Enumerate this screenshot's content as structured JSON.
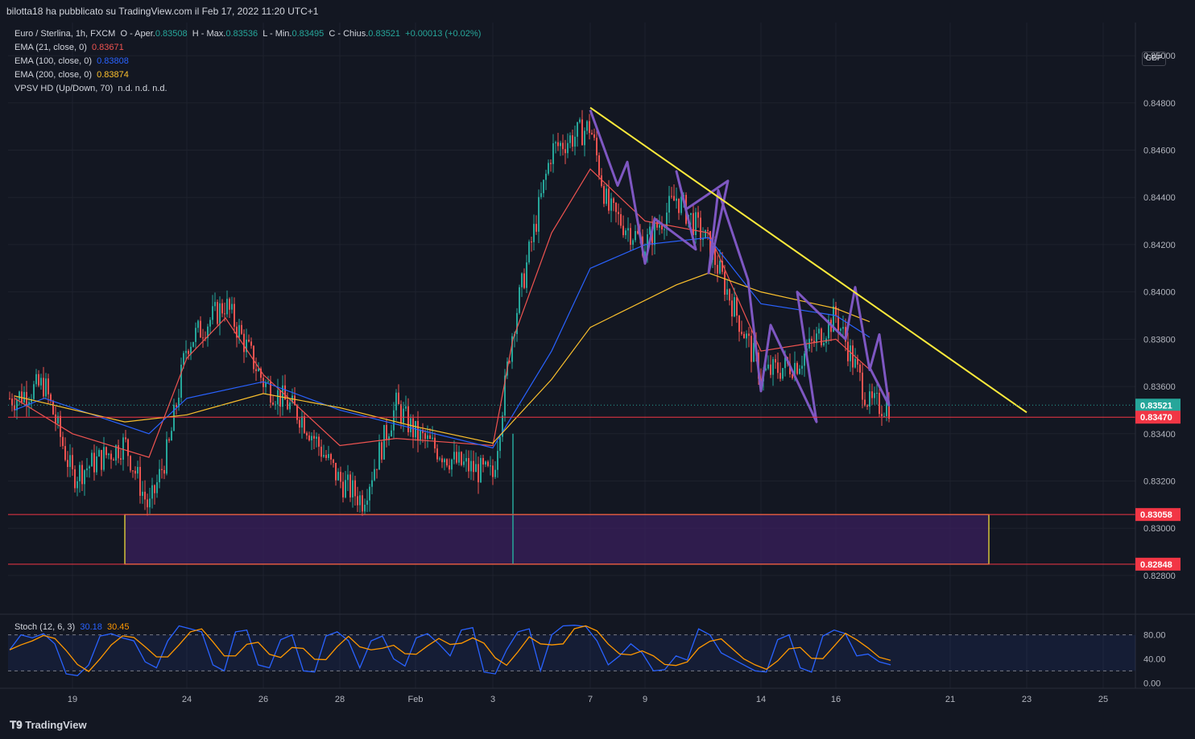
{
  "header": {
    "published": "bilotta18 ha pubblicato su TradingView.com il Feb 17, 2022 11:20 UTC+1"
  },
  "legend": {
    "symbol": "Euro / Sterlina, 1h, FXCM",
    "ohlc_prefix_o": "O - Aper.",
    "open": "0.83508",
    "h_prefix": "H - Max.",
    "high": "0.83536",
    "l_prefix": "L - Min.",
    "low": "0.83495",
    "c_prefix": "C - Chius.",
    "close": "0.83521",
    "change": "+0.00013 (+0.02%)",
    "ema21_label": "EMA (21, close, 0)",
    "ema21_value": "0.83671",
    "ema100_label": "EMA (100, close, 0)",
    "ema100_value": "0.83808",
    "ema200_label": "EMA (200, close, 0)",
    "ema200_value": "0.83874",
    "vpsv_label": "VPSV HD (Up/Down, 70)",
    "vpsv_value": "n.d.  n.d.  n.d.",
    "stoch_label": "Stoch (12, 6, 3)",
    "stoch_k": "30.18",
    "stoch_d": "30.45"
  },
  "currency": "GBP",
  "footer": {
    "brand": "TradingView"
  },
  "colors": {
    "background": "#131722",
    "up": "#26a69a",
    "down": "#ef5350",
    "ema21": "#ef5350",
    "ema100": "#2962ff",
    "ema200": "#fbc02d",
    "trendline": "#ffeb3b",
    "pattern": "#7e57c2",
    "level": "#f23645"
  },
  "chart_data": {
    "type": "candlestick",
    "symbol": "EURGBP",
    "interval": "1h",
    "x_ticks": [
      "19",
      "24",
      "26",
      "28",
      "Feb",
      "3",
      "7",
      "9",
      "14",
      "16",
      "21",
      "23",
      "25"
    ],
    "y_ticks": [
      "0.85000",
      "0.84800",
      "0.84600",
      "0.84400",
      "0.84200",
      "0.84000",
      "0.83800",
      "0.83600",
      "0.83400",
      "0.83200",
      "0.83000",
      "0.82800"
    ],
    "ylim": [
      0.8266,
      0.8514
    ],
    "price_labels": [
      {
        "value": 0.83521,
        "text": "0.83521",
        "kind": "last"
      },
      {
        "value": 0.8347,
        "text": "0.83470",
        "kind": "level"
      },
      {
        "value": 0.83058,
        "text": "0.83058",
        "kind": "level"
      },
      {
        "value": 0.82848,
        "text": "0.82848",
        "kind": "level"
      }
    ],
    "demand_zone": {
      "from_date": "2022-01-20",
      "to_date": "2022-02-22",
      "low": 0.82848,
      "high": 0.83058
    },
    "trendline": {
      "start": {
        "date": "2022-02-07",
        "price": 0.8478
      },
      "end": {
        "date": "2022-02-23",
        "price": 0.8349
      }
    },
    "pattern_path": [
      {
        "date": "2022-02-07",
        "price": 0.8477
      },
      {
        "date": "2022-02-08",
        "price": 0.8445
      },
      {
        "date": "2022-02-08",
        "price": 0.8455
      },
      {
        "date": "2022-02-09",
        "price": 0.8412
      },
      {
        "date": "2022-02-09",
        "price": 0.8431
      },
      {
        "date": "2022-02-10",
        "price": 0.8418
      },
      {
        "date": "2022-02-10",
        "price": 0.8451
      },
      {
        "date": "2022-02-10",
        "price": 0.8435
      },
      {
        "date": "2022-02-11",
        "price": 0.8447
      },
      {
        "date": "2022-02-11",
        "price": 0.8408
      },
      {
        "date": "2022-02-11",
        "price": 0.8443
      },
      {
        "date": "2022-02-12",
        "price": 0.8405
      },
      {
        "date": "2022-02-14",
        "price": 0.8358
      },
      {
        "date": "2022-02-14",
        "price": 0.8386
      },
      {
        "date": "2022-02-15",
        "price": 0.8345
      },
      {
        "date": "2022-02-15",
        "price": 0.84
      },
      {
        "date": "2022-02-16",
        "price": 0.838
      },
      {
        "date": "2022-02-16",
        "price": 0.8402
      },
      {
        "date": "2022-02-17",
        "price": 0.8367
      },
      {
        "date": "2022-02-17",
        "price": 0.8382
      },
      {
        "date": "2022-02-17",
        "price": 0.8352
      },
      {
        "date": "2022-02-17",
        "price": 0.8368
      }
    ],
    "close_path": [
      {
        "date": "2022-01-17",
        "price": 0.8355
      },
      {
        "date": "2022-01-18",
        "price": 0.8361
      },
      {
        "date": "2022-01-19",
        "price": 0.8322
      },
      {
        "date": "2022-01-20",
        "price": 0.8336
      },
      {
        "date": "2022-01-21",
        "price": 0.8308
      },
      {
        "date": "2022-01-22",
        "price": 0.8335
      },
      {
        "date": "2022-01-24",
        "price": 0.8378
      },
      {
        "date": "2022-01-25",
        "price": 0.8395
      },
      {
        "date": "2022-01-26",
        "price": 0.8362
      },
      {
        "date": "2022-01-27",
        "price": 0.8347
      },
      {
        "date": "2022-01-28",
        "price": 0.832
      },
      {
        "date": "2022-01-29",
        "price": 0.8312
      },
      {
        "date": "2022-01-31",
        "price": 0.8352
      },
      {
        "date": "2022-02-01",
        "price": 0.834
      },
      {
        "date": "2022-02-02",
        "price": 0.8328
      },
      {
        "date": "2022-02-03",
        "price": 0.8322
      },
      {
        "date": "2022-02-04",
        "price": 0.8385
      },
      {
        "date": "2022-02-05",
        "price": 0.846
      },
      {
        "date": "2022-02-07",
        "price": 0.847
      },
      {
        "date": "2022-02-08",
        "price": 0.8435
      },
      {
        "date": "2022-02-09",
        "price": 0.842
      },
      {
        "date": "2022-02-10",
        "price": 0.844
      },
      {
        "date": "2022-02-11",
        "price": 0.842
      },
      {
        "date": "2022-02-14",
        "price": 0.8365
      },
      {
        "date": "2022-02-15",
        "price": 0.837
      },
      {
        "date": "2022-02-16",
        "price": 0.839
      },
      {
        "date": "2022-02-17",
        "price": 0.83521
      }
    ],
    "ema21_path": [
      {
        "date": "2022-01-17",
        "price": 0.8355
      },
      {
        "date": "2022-01-19",
        "price": 0.834
      },
      {
        "date": "2022-01-21",
        "price": 0.833
      },
      {
        "date": "2022-01-24",
        "price": 0.8372
      },
      {
        "date": "2022-01-25",
        "price": 0.8389
      },
      {
        "date": "2022-01-26",
        "price": 0.8365
      },
      {
        "date": "2022-01-28",
        "price": 0.8335
      },
      {
        "date": "2022-01-31",
        "price": 0.8338
      },
      {
        "date": "2022-02-03",
        "price": 0.8335
      },
      {
        "date": "2022-02-04",
        "price": 0.838
      },
      {
        "date": "2022-02-05",
        "price": 0.8425
      },
      {
        "date": "2022-02-07",
        "price": 0.8452
      },
      {
        "date": "2022-02-09",
        "price": 0.843
      },
      {
        "date": "2022-02-11",
        "price": 0.8425
      },
      {
        "date": "2022-02-14",
        "price": 0.8375
      },
      {
        "date": "2022-02-16",
        "price": 0.838
      },
      {
        "date": "2022-02-17",
        "price": 0.83671
      }
    ],
    "ema100_path": [
      {
        "date": "2022-01-17",
        "price": 0.835
      },
      {
        "date": "2022-01-18",
        "price": 0.8355
      },
      {
        "date": "2022-01-21",
        "price": 0.834
      },
      {
        "date": "2022-01-24",
        "price": 0.8355
      },
      {
        "date": "2022-01-26",
        "price": 0.8362
      },
      {
        "date": "2022-01-28",
        "price": 0.835
      },
      {
        "date": "2022-02-01",
        "price": 0.8342
      },
      {
        "date": "2022-02-03",
        "price": 0.8334
      },
      {
        "date": "2022-02-05",
        "price": 0.8375
      },
      {
        "date": "2022-02-07",
        "price": 0.841
      },
      {
        "date": "2022-02-09",
        "price": 0.842
      },
      {
        "date": "2022-02-11",
        "price": 0.8423
      },
      {
        "date": "2022-02-14",
        "price": 0.8395
      },
      {
        "date": "2022-02-16",
        "price": 0.839
      },
      {
        "date": "2022-02-17",
        "price": 0.83808
      }
    ],
    "ema200_path": [
      {
        "date": "2022-01-17",
        "price": 0.8356
      },
      {
        "date": "2022-01-20",
        "price": 0.8345
      },
      {
        "date": "2022-01-24",
        "price": 0.8348
      },
      {
        "date": "2022-01-26",
        "price": 0.8357
      },
      {
        "date": "2022-01-28",
        "price": 0.8351
      },
      {
        "date": "2022-02-01",
        "price": 0.8343
      },
      {
        "date": "2022-02-03",
        "price": 0.8336
      },
      {
        "date": "2022-02-05",
        "price": 0.8363
      },
      {
        "date": "2022-02-07",
        "price": 0.8385
      },
      {
        "date": "2022-02-10",
        "price": 0.8403
      },
      {
        "date": "2022-02-11",
        "price": 0.8408
      },
      {
        "date": "2022-02-14",
        "price": 0.84
      },
      {
        "date": "2022-02-16",
        "price": 0.8393
      },
      {
        "date": "2022-02-17",
        "price": 0.83874
      }
    ],
    "stoch": {
      "ylim": [
        -5,
        105
      ],
      "y_ticks": [
        "80.00",
        "40.00",
        "0.00"
      ],
      "band": [
        20,
        80
      ],
      "k": [
        55,
        80,
        75,
        82,
        65,
        15,
        12,
        30,
        78,
        82,
        75,
        70,
        35,
        25,
        70,
        95,
        90,
        85,
        30,
        20,
        85,
        88,
        30,
        25,
        72,
        80,
        20,
        18,
        78,
        85,
        70,
        25,
        70,
        78,
        40,
        28,
        75,
        82,
        65,
        45,
        88,
        92,
        18,
        15,
        55,
        85,
        90,
        20,
        80,
        95,
        96,
        94,
        70,
        30,
        45,
        65,
        50,
        20,
        22,
        45,
        38,
        90,
        80,
        50,
        40,
        30,
        20,
        18,
        72,
        80,
        25,
        18,
        78,
        88,
        82,
        45,
        48,
        35,
        30
      ]
    }
  }
}
